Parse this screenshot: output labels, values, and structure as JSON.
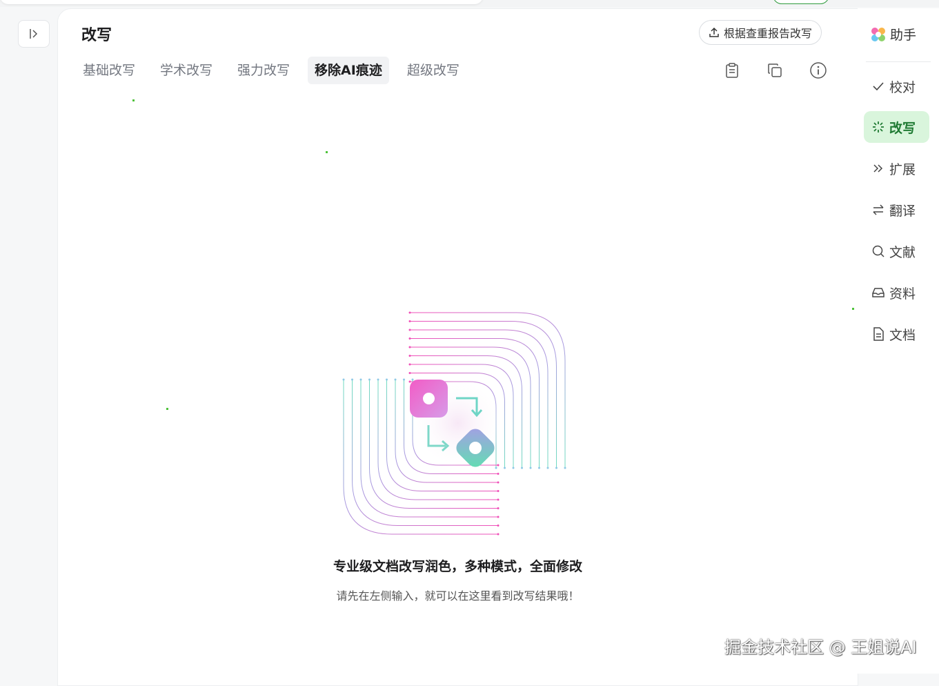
{
  "header": {
    "title": "改写",
    "report_button": "根据查重报告改写"
  },
  "tabs": [
    {
      "label": "基础改写",
      "active": false
    },
    {
      "label": "学术改写",
      "active": false
    },
    {
      "label": "强力改写",
      "active": false
    },
    {
      "label": "移除AI痕迹",
      "active": true
    },
    {
      "label": "超级改写",
      "active": false
    }
  ],
  "toolbar_icons": [
    "clipboard-icon",
    "copy-icon",
    "info-icon"
  ],
  "empty_state": {
    "title": "专业级文档改写润色，多种模式，全面修改",
    "subtitle": "请先在左侧输入，就可以在这里看到改写结果哦！"
  },
  "sidebar": {
    "assistant_label": "助手",
    "items": [
      {
        "label": "校对",
        "icon": "check-icon",
        "active": false
      },
      {
        "label": "改写",
        "icon": "sparkle-icon",
        "active": true
      },
      {
        "label": "扩展",
        "icon": "double-chevron-icon",
        "active": false
      },
      {
        "label": "翻译",
        "icon": "swap-arrows-icon",
        "active": false
      },
      {
        "label": "文献",
        "icon": "search-icon",
        "active": false
      },
      {
        "label": "资料",
        "icon": "inbox-icon",
        "active": false
      },
      {
        "label": "文档",
        "icon": "document-icon",
        "active": false
      }
    ]
  },
  "watermark": "掘金技术社区 @ 王姐说AI",
  "colors": {
    "accent_green": "#1f7a33",
    "active_bg": "#d9f5dc",
    "gradient_pink": "#f04fb8",
    "gradient_teal": "#5fd9b3"
  }
}
